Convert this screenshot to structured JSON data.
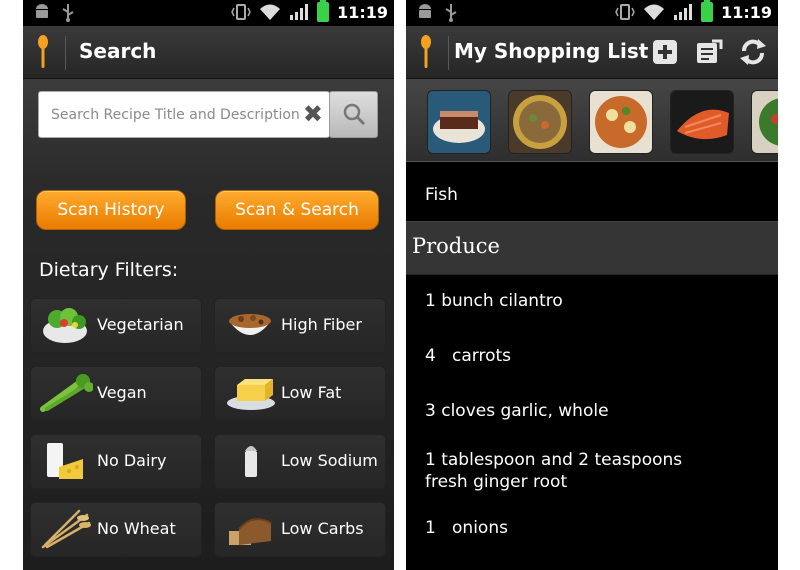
{
  "status_bar": {
    "time": "11:19",
    "icons": [
      "android-icon",
      "usb-icon",
      "vibrate-icon",
      "wifi-icon",
      "signal-icon",
      "battery-icon"
    ]
  },
  "search_screen": {
    "title": "Search",
    "search": {
      "placeholder": "Search Recipe Title and Description",
      "value": ""
    },
    "buttons": {
      "scan_history": "Scan History",
      "scan_search": "Scan & Search"
    },
    "filters_heading": "Dietary Filters:",
    "filters": [
      {
        "label": "Vegetarian",
        "icon": "salad-icon"
      },
      {
        "label": "High Fiber",
        "icon": "cereal-bowl-icon"
      },
      {
        "label": "Vegan",
        "icon": "celery-icon"
      },
      {
        "label": "Low Fat",
        "icon": "butter-icon"
      },
      {
        "label": "No Dairy",
        "icon": "milk-cheese-icon"
      },
      {
        "label": "Low Sodium",
        "icon": "salt-shaker-icon"
      },
      {
        "label": "No Wheat",
        "icon": "wheat-icon"
      },
      {
        "label": "Low Carbs",
        "icon": "bread-icon"
      }
    ],
    "accent": "#f7941d"
  },
  "shopping_screen": {
    "title": "My Shopping List",
    "actions": [
      "add-icon",
      "edit-list-icon",
      "sync-icon"
    ],
    "thumbnails": [
      "dessert-thumb",
      "soup-thumb",
      "stew-thumb",
      "salmon-thumb",
      "salad-thumb"
    ],
    "items": [
      {
        "type": "item",
        "text": "Fish"
      },
      {
        "type": "header",
        "text": "Produce"
      },
      {
        "type": "item",
        "text": "1 bunch cilantro"
      },
      {
        "type": "item",
        "text": "4   carrots"
      },
      {
        "type": "item",
        "text": "3 cloves garlic, whole"
      },
      {
        "type": "item",
        "text": "1 tablespoon and 2 teaspoons fresh ginger root"
      },
      {
        "type": "item",
        "text": "1   onions"
      }
    ]
  }
}
